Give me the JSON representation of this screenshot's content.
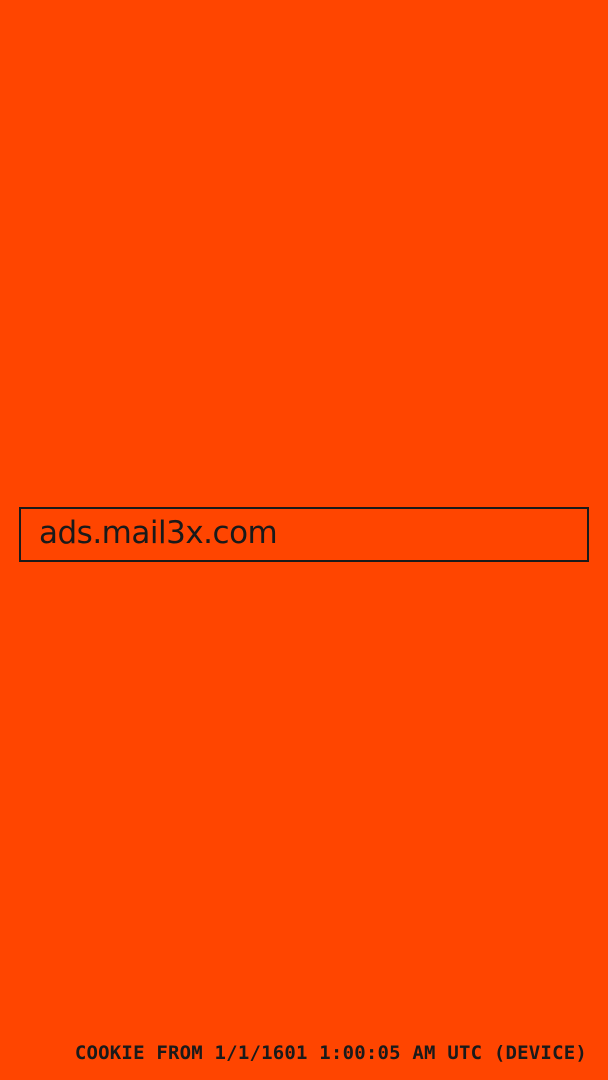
{
  "theme": {
    "background": "#ff4500",
    "foreground": "#1a1a1a"
  },
  "domain_field": {
    "text": "ads.mail3x.com"
  },
  "footer": {
    "cookie_info": "COOKIE FROM 1/1/1601 1:00:05 AM UTC (DEVICE)"
  }
}
